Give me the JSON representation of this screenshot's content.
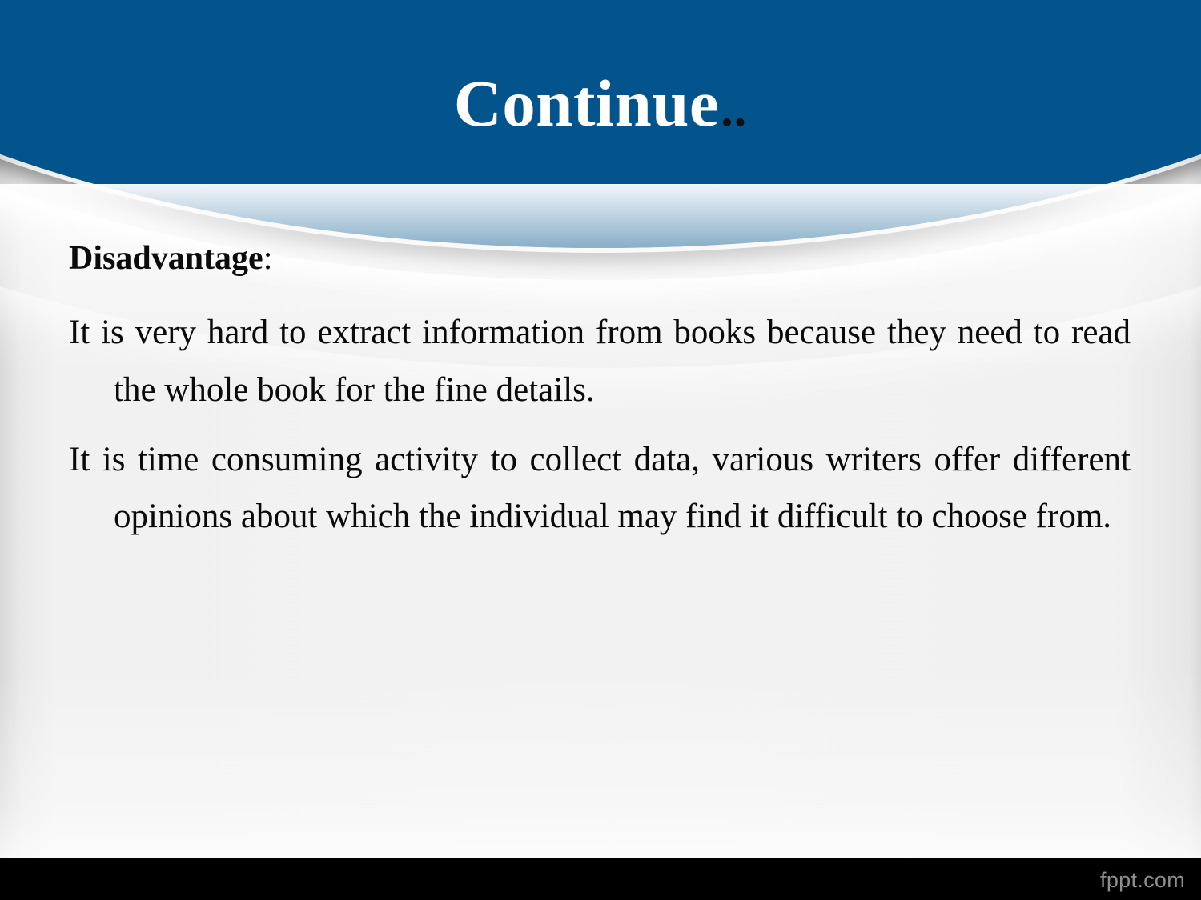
{
  "slide": {
    "title_main": "Continue",
    "title_dots": "..",
    "heading_text": "Disadvantage",
    "heading_colon": ":",
    "paragraphs": [
      "It is very hard to extract information from books because they need to read the whole book for the fine details.",
      "It is time consuming activity to collect data, various writers offer different opinions about which the individual may find it difficult to choose from."
    ],
    "watermark": "fppt.com"
  },
  "colors": {
    "header_blue": "#03548c",
    "body_background": "#f1f1f1",
    "title_text": "#ffffff",
    "title_dots": "#111111",
    "body_text": "#0a0a0a",
    "footer_bar": "#000000",
    "watermark_text": "#8e8e8e"
  }
}
